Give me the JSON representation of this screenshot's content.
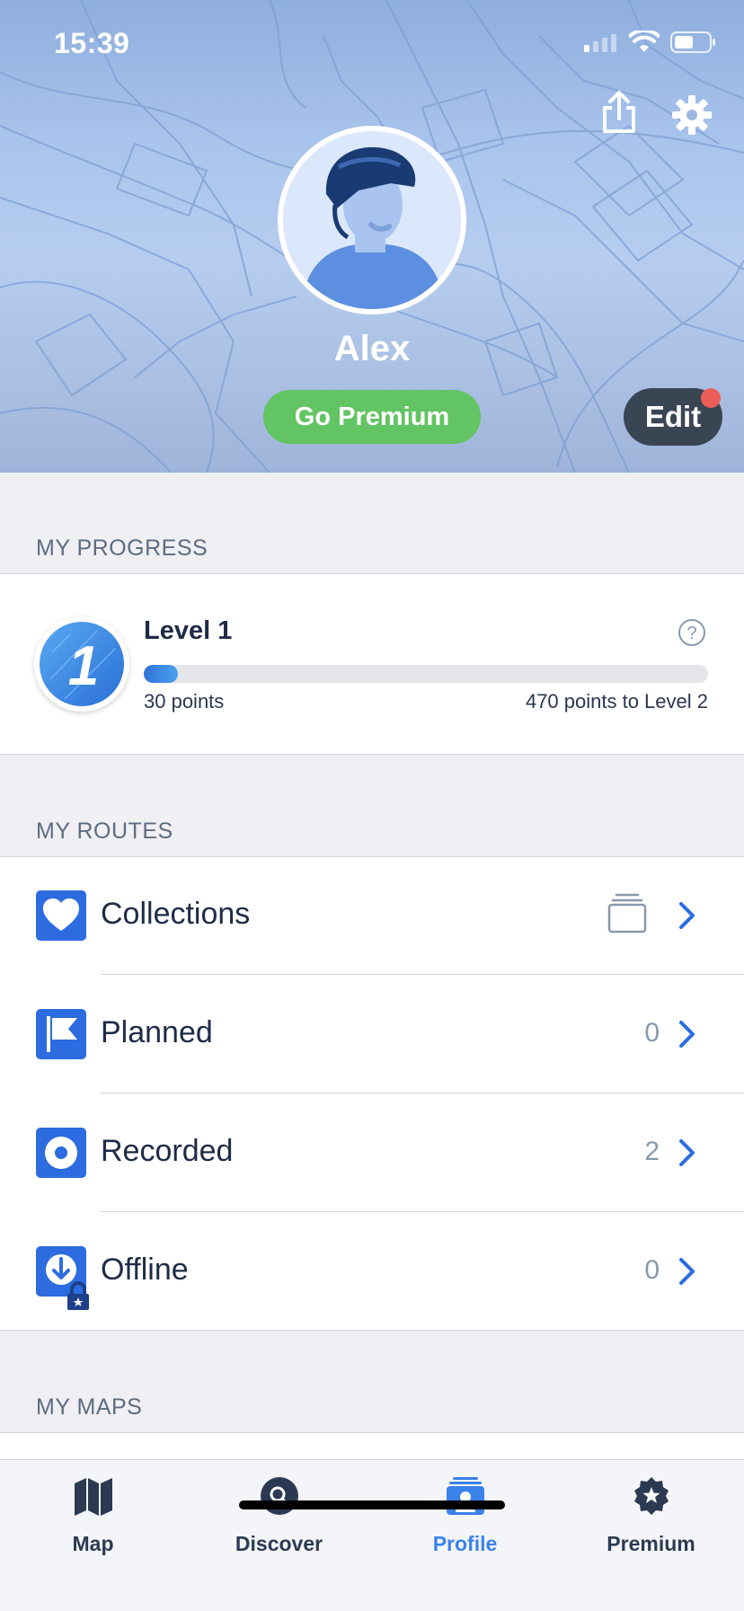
{
  "status_bar": {
    "time": "15:39"
  },
  "profile": {
    "name": "Alex",
    "premium_button": "Go Premium",
    "edit_button": "Edit"
  },
  "progress": {
    "section_title": "MY PROGRESS",
    "level_number": "1",
    "level_title": "Level 1",
    "points": "30 points",
    "points_to_next": "470 points to Level 2",
    "fraction": 0.06,
    "help_symbol": "?"
  },
  "routes": {
    "section_title": "MY ROUTES",
    "items": [
      {
        "label": "Collections",
        "count": "",
        "icon": "heart-icon"
      },
      {
        "label": "Planned",
        "count": "0",
        "icon": "flag-icon"
      },
      {
        "label": "Recorded",
        "count": "2",
        "icon": "record-icon"
      },
      {
        "label": "Offline",
        "count": "0",
        "icon": "download-lock-icon"
      }
    ]
  },
  "maps": {
    "section_title": "MY MAPS"
  },
  "tabbar": {
    "tabs": [
      {
        "label": "Map",
        "icon": "map-icon",
        "active": false
      },
      {
        "label": "Discover",
        "icon": "search-icon",
        "active": false
      },
      {
        "label": "Profile",
        "icon": "profile-icon",
        "active": true
      },
      {
        "label": "Premium",
        "icon": "star-badge-icon",
        "active": false
      }
    ]
  },
  "colors": {
    "accent": "#2c6ce0",
    "premium_green": "#62c462",
    "active_tab": "#3a82ea",
    "notification": "#ec5f59"
  }
}
